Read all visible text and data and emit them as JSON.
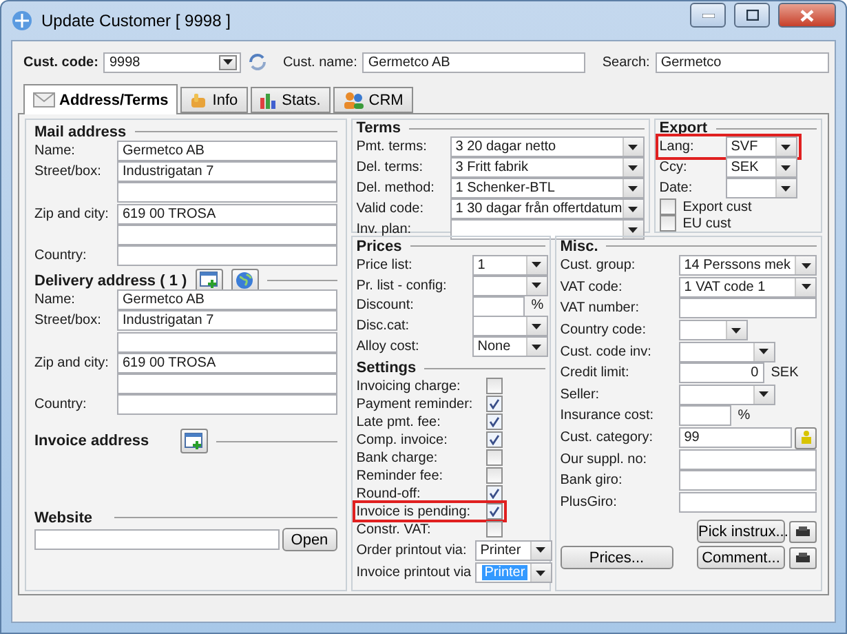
{
  "window": {
    "title": "Update Customer [ 9998 ]"
  },
  "header": {
    "cust_code": {
      "label": "Cust. code:",
      "value": "9998"
    },
    "cust_name": {
      "label": "Cust. name:",
      "value": "Germetco AB"
    },
    "search": {
      "label": "Search:",
      "value": "Germetco"
    }
  },
  "tabs": [
    {
      "label": "Address/Terms",
      "selected": true
    },
    {
      "label": "Info",
      "selected": false
    },
    {
      "label": "Stats.",
      "selected": false
    },
    {
      "label": "CRM",
      "selected": false
    }
  ],
  "mail_address": {
    "title": "Mail address",
    "fields": [
      {
        "kind": "field",
        "label": "Name:",
        "value": "Germetco AB"
      },
      {
        "kind": "field",
        "label": "Street/box:",
        "value": "Industrigatan 7"
      },
      {
        "kind": "blank"
      },
      {
        "kind": "field",
        "label": "Zip and city:",
        "value": "619 00  TROSA"
      },
      {
        "kind": "blank"
      },
      {
        "kind": "field",
        "label": "Country:"
      }
    ]
  },
  "delivery_address": {
    "title": "Delivery address ( 1 )",
    "fields": [
      {
        "kind": "field",
        "label": "Name:",
        "value": "Germetco AB"
      },
      {
        "kind": "field",
        "label": "Street/box:",
        "value": "Industrigatan 7"
      },
      {
        "kind": "blank"
      },
      {
        "kind": "field",
        "label": "Zip and city:",
        "value": "619 00  TROSA"
      },
      {
        "kind": "blank"
      },
      {
        "kind": "field",
        "label": "Country:"
      }
    ]
  },
  "invoice_address": {
    "title": "Invoice address"
  },
  "website": {
    "title": "Website",
    "button": "Open"
  },
  "terms": {
    "title": "Terms",
    "rows": [
      {
        "label": "Pmt. terms:",
        "value": "3  20 dagar netto"
      },
      {
        "label": "Del. terms:",
        "value": "3  Fritt fabrik"
      },
      {
        "label": "Del. method:",
        "value": "1  Schenker-BTL"
      },
      {
        "label": "Valid code:",
        "value": "1  30 dagar från offertdatum"
      },
      {
        "label": "Inv. plan:"
      }
    ]
  },
  "export": {
    "title": "Export",
    "rows": [
      {
        "label": "Lang:",
        "value": "SVF",
        "highlighted": true
      },
      {
        "label": "Ccy:",
        "value": "SEK",
        "highlighted": false
      },
      {
        "label": "Date:",
        "highlighted": false
      }
    ],
    "checks": [
      {
        "label": "Export cust",
        "checked": false
      },
      {
        "label": "EU cust",
        "checked": false
      }
    ]
  },
  "prices": {
    "title": "Prices",
    "rows": [
      {
        "kind": "combo",
        "label": "Price list:",
        "value": "1"
      },
      {
        "kind": "combo",
        "label": "Pr. list - config:"
      },
      {
        "kind": "input",
        "label": "Discount:",
        "suffix": "%"
      },
      {
        "kind": "combo",
        "label": "Disc.cat:"
      },
      {
        "kind": "combo",
        "label": "Alloy cost:",
        "value": "None"
      }
    ]
  },
  "settings": {
    "title": "Settings",
    "checks": [
      {
        "label": "Invoicing charge:",
        "checked": false,
        "highlighted": false
      },
      {
        "label": "Payment reminder:",
        "checked": true,
        "highlighted": false
      },
      {
        "label": "Late pmt. fee:",
        "checked": true,
        "highlighted": false
      },
      {
        "label": "Comp. invoice:",
        "checked": true,
        "highlighted": false
      },
      {
        "label": "Bank charge:",
        "checked": false,
        "highlighted": false
      },
      {
        "label": "Reminder fee:",
        "checked": false,
        "highlighted": false
      },
      {
        "label": "Round-off:",
        "checked": true,
        "highlighted": false
      },
      {
        "label": "Invoice is pending:",
        "checked": true,
        "highlighted": true
      },
      {
        "label": "Constr. VAT:",
        "checked": false,
        "highlighted": false
      }
    ],
    "printouts": [
      {
        "label": "Order printout via:",
        "value": "Printer",
        "selected": false
      },
      {
        "label": "Invoice printout via",
        "value": "Printer",
        "selected": true
      }
    ]
  },
  "misc": {
    "title": "Misc.",
    "rows": [
      {
        "kind": "combo",
        "label": "Cust. group:",
        "value": "14  Perssons mek"
      },
      {
        "kind": "combo",
        "label": "VAT code:",
        "value": "1  VAT code 1"
      },
      {
        "kind": "input",
        "label": "VAT number:"
      },
      {
        "kind": "short_combo",
        "label": "Country code:"
      },
      {
        "kind": "mid_combo",
        "label": "Cust. code inv:"
      },
      {
        "kind": "amount",
        "label": "Credit limit:",
        "value": "0",
        "suffix": "SEK"
      },
      {
        "kind": "mid_combo",
        "label": "Seller:"
      },
      {
        "kind": "short_input",
        "label": "Insurance cost:",
        "suffix": "%"
      },
      {
        "kind": "lookup",
        "label": "Cust. category:",
        "value": "99"
      },
      {
        "kind": "input",
        "label": "Our suppl. no:"
      },
      {
        "kind": "input",
        "label": "Bank giro:"
      },
      {
        "kind": "input",
        "label": "PlusGiro:"
      }
    ],
    "buttons": {
      "pick": "Pick instrux...",
      "prices": "Prices...",
      "comment": "Comment..."
    }
  }
}
